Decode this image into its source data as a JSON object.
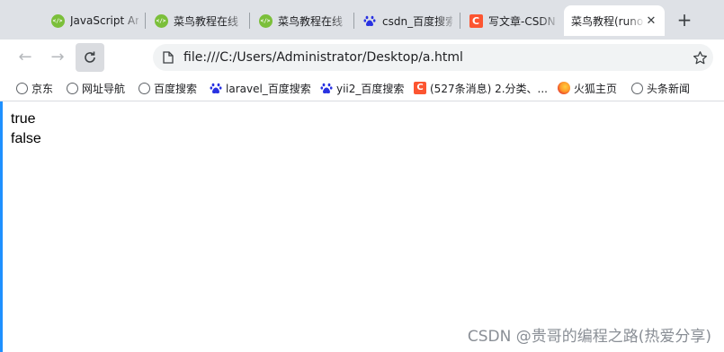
{
  "tabs": [
    {
      "title": "JavaScript Ar",
      "favicon": "runoob-icon",
      "active": false
    },
    {
      "title": "菜鸟教程在线",
      "favicon": "runoob-icon",
      "active": false
    },
    {
      "title": "菜鸟教程在线",
      "favicon": "runoob-icon",
      "active": false
    },
    {
      "title": "csdn_百度搜索",
      "favicon": "baidu-paw-icon",
      "active": false
    },
    {
      "title": "写文章-CSDN",
      "favicon": "csdn-icon",
      "active": false
    },
    {
      "title": "菜鸟教程(runoob",
      "favicon": "none",
      "active": true
    }
  ],
  "address_bar": {
    "url": "file:///C:/Users/Administrator/Desktop/a.html"
  },
  "bookmarks": [
    {
      "label": "京东",
      "icon": "globe-icon"
    },
    {
      "label": "网址导航",
      "icon": "globe-icon"
    },
    {
      "label": "百度搜索",
      "icon": "globe-icon"
    },
    {
      "label": "laravel_百度搜索",
      "icon": "baidu-paw-icon"
    },
    {
      "label": "yii2_百度搜索",
      "icon": "baidu-paw-icon"
    },
    {
      "label": "(527条消息) 2.分类、...",
      "icon": "csdn-icon"
    },
    {
      "label": "火狐主页",
      "icon": "firefox-icon"
    },
    {
      "label": "头条新闻",
      "icon": "globe-icon"
    }
  ],
  "page": {
    "lines": [
      "true",
      "false"
    ]
  },
  "watermark": "CSDN @贵哥的编程之路(热爱分享)",
  "colors": {
    "accent": "#1e90ff",
    "csdn": "#fc5531",
    "runoob": "#7bbf3a",
    "baidu": "#2932e1"
  }
}
